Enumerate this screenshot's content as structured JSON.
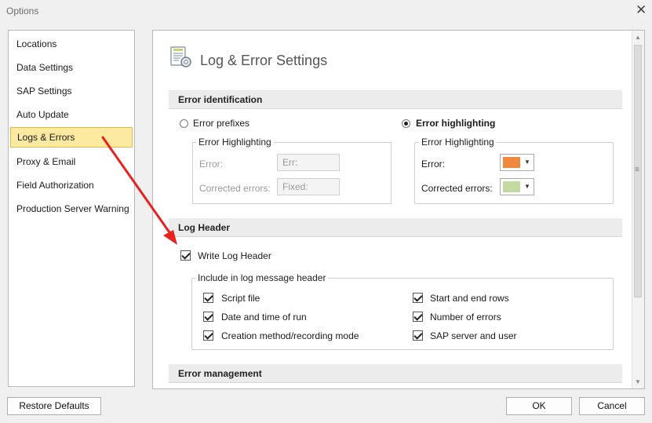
{
  "window": {
    "title": "Options",
    "close_symbol": "✕"
  },
  "nav": {
    "items": [
      {
        "label": "Locations"
      },
      {
        "label": "Data Settings"
      },
      {
        "label": "SAP Settings"
      },
      {
        "label": "Auto Update"
      },
      {
        "label": "Logs & Errors",
        "selected": true
      },
      {
        "label": "Proxy & Email"
      },
      {
        "label": "Field Authorization"
      },
      {
        "label": "Production Server Warning"
      }
    ]
  },
  "panel": {
    "title": "Log & Error Settings",
    "error_identification": {
      "header": "Error identification",
      "prefixes_option": {
        "label": "Error prefixes",
        "selected": false
      },
      "highlighting_option": {
        "label": "Error highlighting",
        "selected": true
      },
      "prefix_group": {
        "title": "Error Highlighting",
        "error_label": "Error:",
        "error_value": "Err:",
        "corrected_label": "Corrected errors:",
        "corrected_value": "Fixed:"
      },
      "highlight_group": {
        "title": "Error Highlighting",
        "error_label": "Error:",
        "error_color": "#f0883e",
        "corrected_label": "Corrected errors:",
        "corrected_color": "#c3dba0"
      }
    },
    "log_header": {
      "header": "Log Header",
      "write_log_header": {
        "label": "Write Log Header",
        "checked": true
      },
      "include_group": {
        "title": "Include in log message header",
        "left_items": [
          {
            "label": "Script file",
            "checked": true
          },
          {
            "label": "Date and time of run",
            "checked": true
          },
          {
            "label": "Creation method/recording mode",
            "checked": true
          }
        ],
        "right_items": [
          {
            "label": "Start and end rows",
            "checked": true
          },
          {
            "label": "Number of errors",
            "checked": true
          },
          {
            "label": "SAP server and user",
            "checked": true
          }
        ]
      }
    },
    "error_management": {
      "header": "Error management"
    }
  },
  "footer": {
    "restore_defaults": "Restore Defaults",
    "ok": "OK",
    "cancel": "Cancel"
  },
  "annotation": {
    "arrow_color": "#e8231f"
  }
}
